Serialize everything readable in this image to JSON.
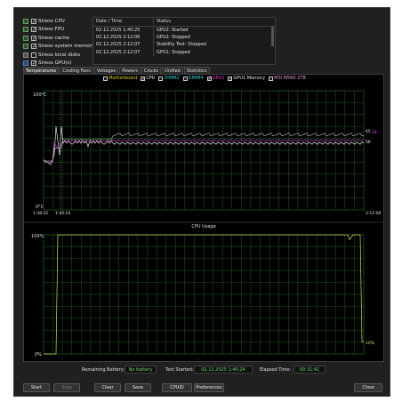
{
  "stress_options": [
    {
      "label": "Stress CPU",
      "checked": true,
      "icon": "cpu-icon"
    },
    {
      "label": "Stress FPU",
      "checked": true,
      "icon": "fpu-icon"
    },
    {
      "label": "Stress cache",
      "checked": true,
      "icon": "cache-icon"
    },
    {
      "label": "Stress system memory",
      "checked": true,
      "icon": "memory-icon"
    },
    {
      "label": "Stress local disks",
      "checked": false,
      "icon": "disk-icon"
    },
    {
      "label": "Stress GPU(s)",
      "checked": true,
      "icon": "gpu-icon"
    }
  ],
  "log": {
    "columns": [
      "Date / Time",
      "Status"
    ],
    "rows": [
      [
        "02.12.2025 1:40:25",
        "GPU2: Started"
      ],
      [
        "02.12.2025 2:12:06",
        "GPU2: Stopped"
      ],
      [
        "02.12.2025 2:12:07",
        "Stability Test: Stopped"
      ],
      [
        "02.12.2025 2:12:07",
        "GPU1: Stopped"
      ]
    ]
  },
  "tabs": [
    "Temperatures",
    "Cooling Fans",
    "Voltages",
    "Powers",
    "Clocks",
    "Unified",
    "Statistics"
  ],
  "temp_legend": [
    {
      "label": "Motherboard",
      "checked": false,
      "color": "#e8d000"
    },
    {
      "label": "CPU",
      "checked": true,
      "color": "#ffffff"
    },
    {
      "label": "DIMM2",
      "checked": false,
      "color": "#38d0d0"
    },
    {
      "label": "DIMM4",
      "checked": false,
      "color": "#38d0d0"
    },
    {
      "label": "GPU1",
      "checked": true,
      "color": "#e040e0"
    },
    {
      "label": "GPU1 Memory",
      "checked": true,
      "color": "#e8e8e8"
    },
    {
      "label": "MSI M560 2TB",
      "checked": false,
      "color": "#e8a0d0"
    }
  ],
  "temp_chart": {
    "y_top_label": "100°C",
    "y_bottom_label": "0°C",
    "x_start_label": "1:38:41",
    "x_marker_label": "1:40:24",
    "x_end_label": "2:12:06",
    "value_labels": [
      "65",
      "58",
      "56"
    ]
  },
  "cpu_chart": {
    "title": "CPU Usage",
    "y_top_label": "100%",
    "y_bottom_label": "0%",
    "end_value_label": "10%"
  },
  "status": {
    "battery_label": "Remaining Battery:",
    "battery_value": "No battery",
    "started_label": "Test Started:",
    "started_value": "02.12.2025 1:40:24",
    "elapsed_label": "Elapsed Time:",
    "elapsed_value": "00:31:41"
  },
  "buttons": {
    "start": "Start",
    "stop": "Stop",
    "clear": "Clear",
    "save": "Save",
    "cpuid": "CPUID",
    "preferences": "Preferences",
    "close": "Close"
  },
  "colors": {
    "grid": "#1f7a1f",
    "cpu_line": "#bfe85a",
    "gpu_line": "#e040e0"
  }
}
